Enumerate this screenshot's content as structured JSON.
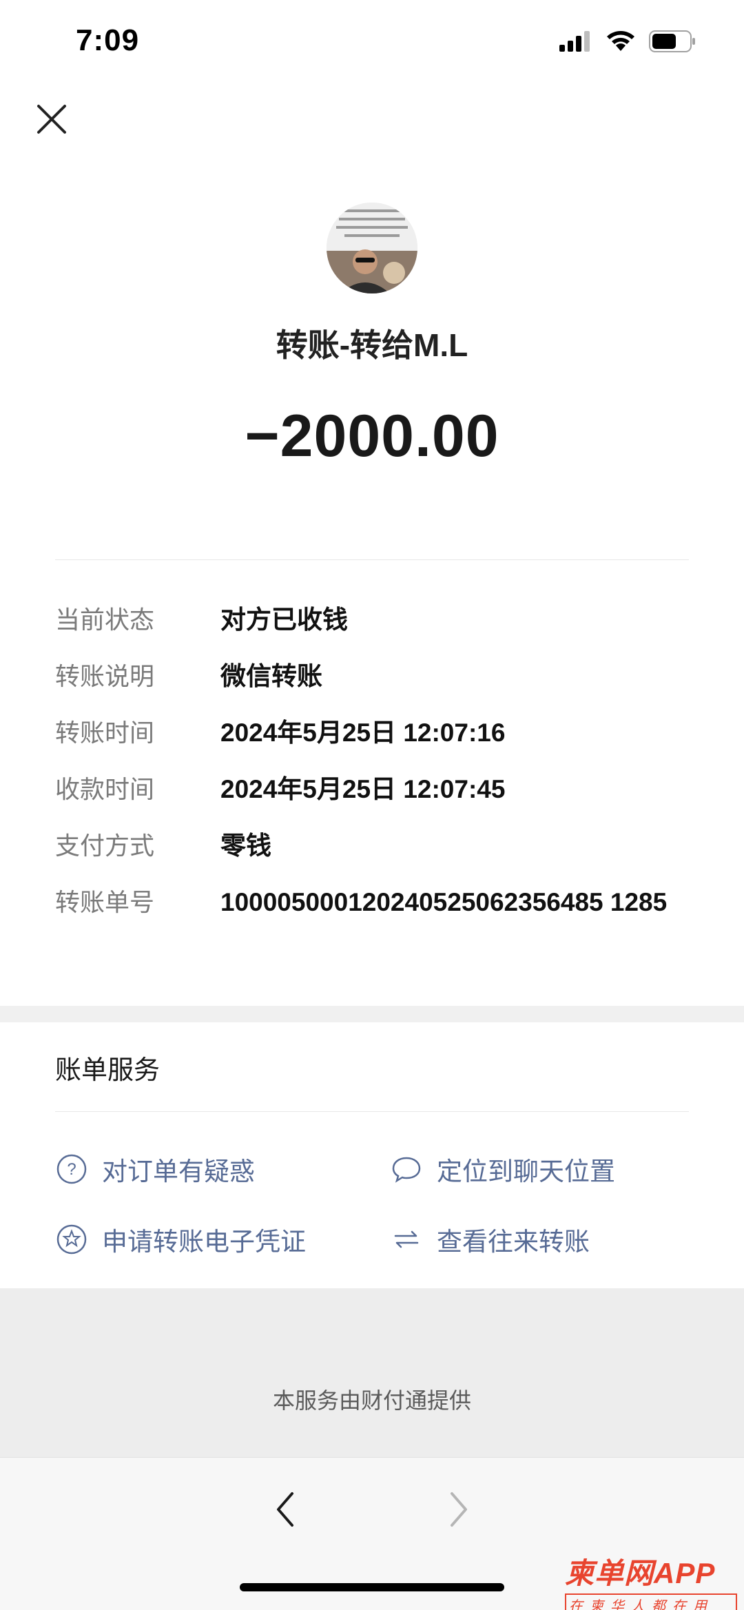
{
  "status_bar": {
    "time": "7:09",
    "battery_level": 0.65
  },
  "header": {
    "avatar_icon": "user-avatar",
    "title": "转账-转给M.L",
    "amount": "−2000.00"
  },
  "details": [
    {
      "label": "当前状态",
      "value": "对方已收钱"
    },
    {
      "label": "转账说明",
      "value": "微信转账"
    },
    {
      "label": "转账时间",
      "value": "2024年5月25日 12:07:16"
    },
    {
      "label": "收款时间",
      "value": "2024年5月25日 12:07:45"
    },
    {
      "label": "支付方式",
      "value": "零钱"
    },
    {
      "label": "转账单号",
      "value": "100005000120240525062356485 1285"
    }
  ],
  "bill_services": {
    "title": "账单服务",
    "items": [
      {
        "label": "对订单有疑惑",
        "icon": "question-icon"
      },
      {
        "label": "定位到聊天位置",
        "icon": "chat-bubble-icon"
      },
      {
        "label": "申请转账电子凭证",
        "icon": "star-badge-icon"
      },
      {
        "label": "查看往来转账",
        "icon": "transfer-arrows-icon"
      }
    ]
  },
  "footer": {
    "text": "本服务由财付通提供"
  },
  "watermark": {
    "main": "柬单网APP",
    "sub": "在柬华人都在用"
  },
  "colors": {
    "link": "#576b95",
    "watermark": "#e8442e"
  }
}
